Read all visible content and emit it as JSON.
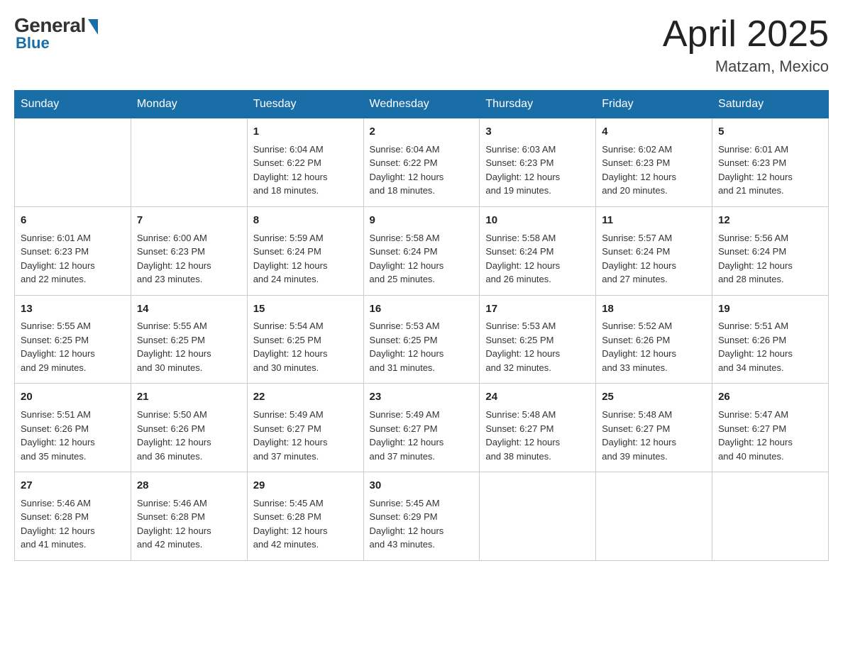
{
  "header": {
    "logo": {
      "general_text": "General",
      "blue_text": "Blue"
    },
    "title": "April 2025",
    "location": "Matzam, Mexico"
  },
  "weekdays": [
    "Sunday",
    "Monday",
    "Tuesday",
    "Wednesday",
    "Thursday",
    "Friday",
    "Saturday"
  ],
  "weeks": [
    [
      {
        "day": "",
        "info": ""
      },
      {
        "day": "",
        "info": ""
      },
      {
        "day": "1",
        "info": "Sunrise: 6:04 AM\nSunset: 6:22 PM\nDaylight: 12 hours\nand 18 minutes."
      },
      {
        "day": "2",
        "info": "Sunrise: 6:04 AM\nSunset: 6:22 PM\nDaylight: 12 hours\nand 18 minutes."
      },
      {
        "day": "3",
        "info": "Sunrise: 6:03 AM\nSunset: 6:23 PM\nDaylight: 12 hours\nand 19 minutes."
      },
      {
        "day": "4",
        "info": "Sunrise: 6:02 AM\nSunset: 6:23 PM\nDaylight: 12 hours\nand 20 minutes."
      },
      {
        "day": "5",
        "info": "Sunrise: 6:01 AM\nSunset: 6:23 PM\nDaylight: 12 hours\nand 21 minutes."
      }
    ],
    [
      {
        "day": "6",
        "info": "Sunrise: 6:01 AM\nSunset: 6:23 PM\nDaylight: 12 hours\nand 22 minutes."
      },
      {
        "day": "7",
        "info": "Sunrise: 6:00 AM\nSunset: 6:23 PM\nDaylight: 12 hours\nand 23 minutes."
      },
      {
        "day": "8",
        "info": "Sunrise: 5:59 AM\nSunset: 6:24 PM\nDaylight: 12 hours\nand 24 minutes."
      },
      {
        "day": "9",
        "info": "Sunrise: 5:58 AM\nSunset: 6:24 PM\nDaylight: 12 hours\nand 25 minutes."
      },
      {
        "day": "10",
        "info": "Sunrise: 5:58 AM\nSunset: 6:24 PM\nDaylight: 12 hours\nand 26 minutes."
      },
      {
        "day": "11",
        "info": "Sunrise: 5:57 AM\nSunset: 6:24 PM\nDaylight: 12 hours\nand 27 minutes."
      },
      {
        "day": "12",
        "info": "Sunrise: 5:56 AM\nSunset: 6:24 PM\nDaylight: 12 hours\nand 28 minutes."
      }
    ],
    [
      {
        "day": "13",
        "info": "Sunrise: 5:55 AM\nSunset: 6:25 PM\nDaylight: 12 hours\nand 29 minutes."
      },
      {
        "day": "14",
        "info": "Sunrise: 5:55 AM\nSunset: 6:25 PM\nDaylight: 12 hours\nand 30 minutes."
      },
      {
        "day": "15",
        "info": "Sunrise: 5:54 AM\nSunset: 6:25 PM\nDaylight: 12 hours\nand 30 minutes."
      },
      {
        "day": "16",
        "info": "Sunrise: 5:53 AM\nSunset: 6:25 PM\nDaylight: 12 hours\nand 31 minutes."
      },
      {
        "day": "17",
        "info": "Sunrise: 5:53 AM\nSunset: 6:25 PM\nDaylight: 12 hours\nand 32 minutes."
      },
      {
        "day": "18",
        "info": "Sunrise: 5:52 AM\nSunset: 6:26 PM\nDaylight: 12 hours\nand 33 minutes."
      },
      {
        "day": "19",
        "info": "Sunrise: 5:51 AM\nSunset: 6:26 PM\nDaylight: 12 hours\nand 34 minutes."
      }
    ],
    [
      {
        "day": "20",
        "info": "Sunrise: 5:51 AM\nSunset: 6:26 PM\nDaylight: 12 hours\nand 35 minutes."
      },
      {
        "day": "21",
        "info": "Sunrise: 5:50 AM\nSunset: 6:26 PM\nDaylight: 12 hours\nand 36 minutes."
      },
      {
        "day": "22",
        "info": "Sunrise: 5:49 AM\nSunset: 6:27 PM\nDaylight: 12 hours\nand 37 minutes."
      },
      {
        "day": "23",
        "info": "Sunrise: 5:49 AM\nSunset: 6:27 PM\nDaylight: 12 hours\nand 37 minutes."
      },
      {
        "day": "24",
        "info": "Sunrise: 5:48 AM\nSunset: 6:27 PM\nDaylight: 12 hours\nand 38 minutes."
      },
      {
        "day": "25",
        "info": "Sunrise: 5:48 AM\nSunset: 6:27 PM\nDaylight: 12 hours\nand 39 minutes."
      },
      {
        "day": "26",
        "info": "Sunrise: 5:47 AM\nSunset: 6:27 PM\nDaylight: 12 hours\nand 40 minutes."
      }
    ],
    [
      {
        "day": "27",
        "info": "Sunrise: 5:46 AM\nSunset: 6:28 PM\nDaylight: 12 hours\nand 41 minutes."
      },
      {
        "day": "28",
        "info": "Sunrise: 5:46 AM\nSunset: 6:28 PM\nDaylight: 12 hours\nand 42 minutes."
      },
      {
        "day": "29",
        "info": "Sunrise: 5:45 AM\nSunset: 6:28 PM\nDaylight: 12 hours\nand 42 minutes."
      },
      {
        "day": "30",
        "info": "Sunrise: 5:45 AM\nSunset: 6:29 PM\nDaylight: 12 hours\nand 43 minutes."
      },
      {
        "day": "",
        "info": ""
      },
      {
        "day": "",
        "info": ""
      },
      {
        "day": "",
        "info": ""
      }
    ]
  ]
}
